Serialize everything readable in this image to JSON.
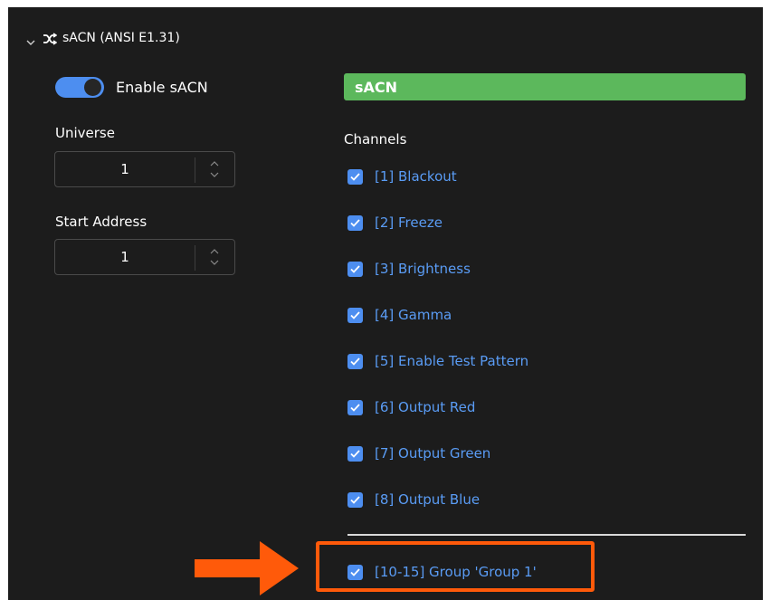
{
  "section": {
    "title": "sACN (ANSI E1.31)",
    "icons": [
      "chevron-down-icon",
      "shuffle-icon"
    ]
  },
  "enable": {
    "label": "Enable sACN",
    "on": true
  },
  "universe": {
    "label": "Universe",
    "value": "1"
  },
  "start_address": {
    "label": "Start Address",
    "value": "1"
  },
  "sacn_bar": {
    "label": "sACN",
    "color": "#5cb85c"
  },
  "channels": {
    "label": "Channels",
    "items": [
      {
        "label": "[1] Blackout",
        "checked": true
      },
      {
        "label": "[2] Freeze",
        "checked": true
      },
      {
        "label": "[3] Brightness",
        "checked": true
      },
      {
        "label": "[4] Gamma",
        "checked": true
      },
      {
        "label": "[5] Enable Test Pattern",
        "checked": true
      },
      {
        "label": "[6] Output Red",
        "checked": true
      },
      {
        "label": "[7] Output Green",
        "checked": true
      },
      {
        "label": "[8] Output Blue",
        "checked": true
      }
    ],
    "group": {
      "label": "[10-15] Group 'Group 1'",
      "checked": true
    }
  },
  "colors": {
    "panel_bg": "#1c1c1c",
    "accent_blue": "#4d8ef0",
    "link_blue": "#5a9cf5",
    "highlight_orange": "#ff5a0a"
  }
}
